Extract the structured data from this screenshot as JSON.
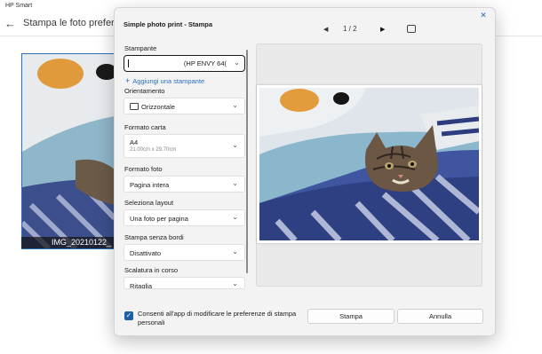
{
  "app": {
    "title": "HP Smart",
    "heading": "Stampa le foto preferite.",
    "thumbnail_caption": "IMG_20210122_"
  },
  "dialog": {
    "title": "Simple photo print - Stampa",
    "close_icon": "close-icon",
    "pager": {
      "text": "1 / 2",
      "prev_icon": "triangle-left-icon",
      "next_icon": "triangle-right-icon",
      "fit_icon": "fit-page-icon"
    },
    "printer": {
      "label": "Stampante",
      "value": "(HP ENVY 64(",
      "add_label": "Aggiungi una stampante"
    },
    "orientation": {
      "label": "Orientamento",
      "value": "Orizzontale"
    },
    "paper_size": {
      "label": "Formato carta",
      "value": "A4",
      "detail": "21.00cm x 29.70cm"
    },
    "photo_size": {
      "label": "Formato foto",
      "value": "Pagina intera"
    },
    "layout": {
      "label": "Seleziona layout",
      "value": "Una foto per pagina"
    },
    "borderless": {
      "label": "Stampa senza bordi",
      "value": "Disattivato"
    },
    "scaling": {
      "label": "Scalatura in corso",
      "value": "Ritaglia"
    },
    "consent": {
      "checked": true,
      "text": "Consenti all'app di modificare le preferenze di stampa personali"
    },
    "print_button": "Stampa",
    "cancel_button": "Annulla"
  },
  "colors": {
    "accent": "#2a6fbe",
    "checkbox": "#1f5fa8",
    "dialog_bg": "#f3f3f3"
  }
}
